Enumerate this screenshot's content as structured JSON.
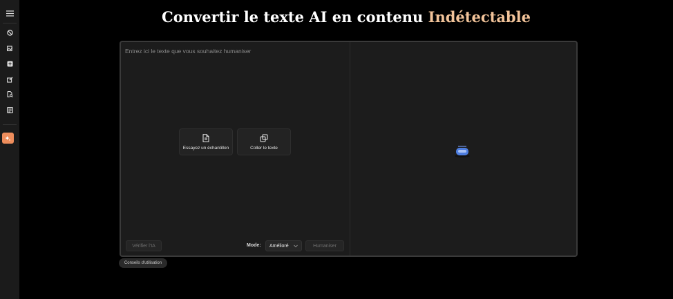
{
  "title": {
    "prefix": "Convertir le texte AI en contenu ",
    "highlight": "Indétectable"
  },
  "sidebar": {
    "items": [
      {
        "icon": "menu-icon"
      },
      {
        "icon": "block-icon"
      },
      {
        "icon": "image-edit-icon"
      },
      {
        "icon": "plus-square-icon"
      },
      {
        "icon": "pen-image-icon"
      },
      {
        "icon": "doc-search-icon"
      },
      {
        "icon": "checklist-icon"
      },
      {
        "icon": "sparkle-icon",
        "active": true
      }
    ]
  },
  "editor": {
    "placeholder": "Entrez ici le texte que vous souhaitez humaniser",
    "sample_label": "Essayez un échantillon",
    "paste_label": "Coller le texte",
    "check_ai_label": "Vérifier l'IA",
    "mode_label": "Mode:",
    "mode_value": "Amélioré",
    "humanize_label": "Humaniser"
  },
  "tips_label": "Conseils d'utilisation",
  "colors": {
    "accent": "#ee8d5c",
    "highlight": "#f3c49a",
    "background": "#000000",
    "panel": "#1c1c1c"
  }
}
